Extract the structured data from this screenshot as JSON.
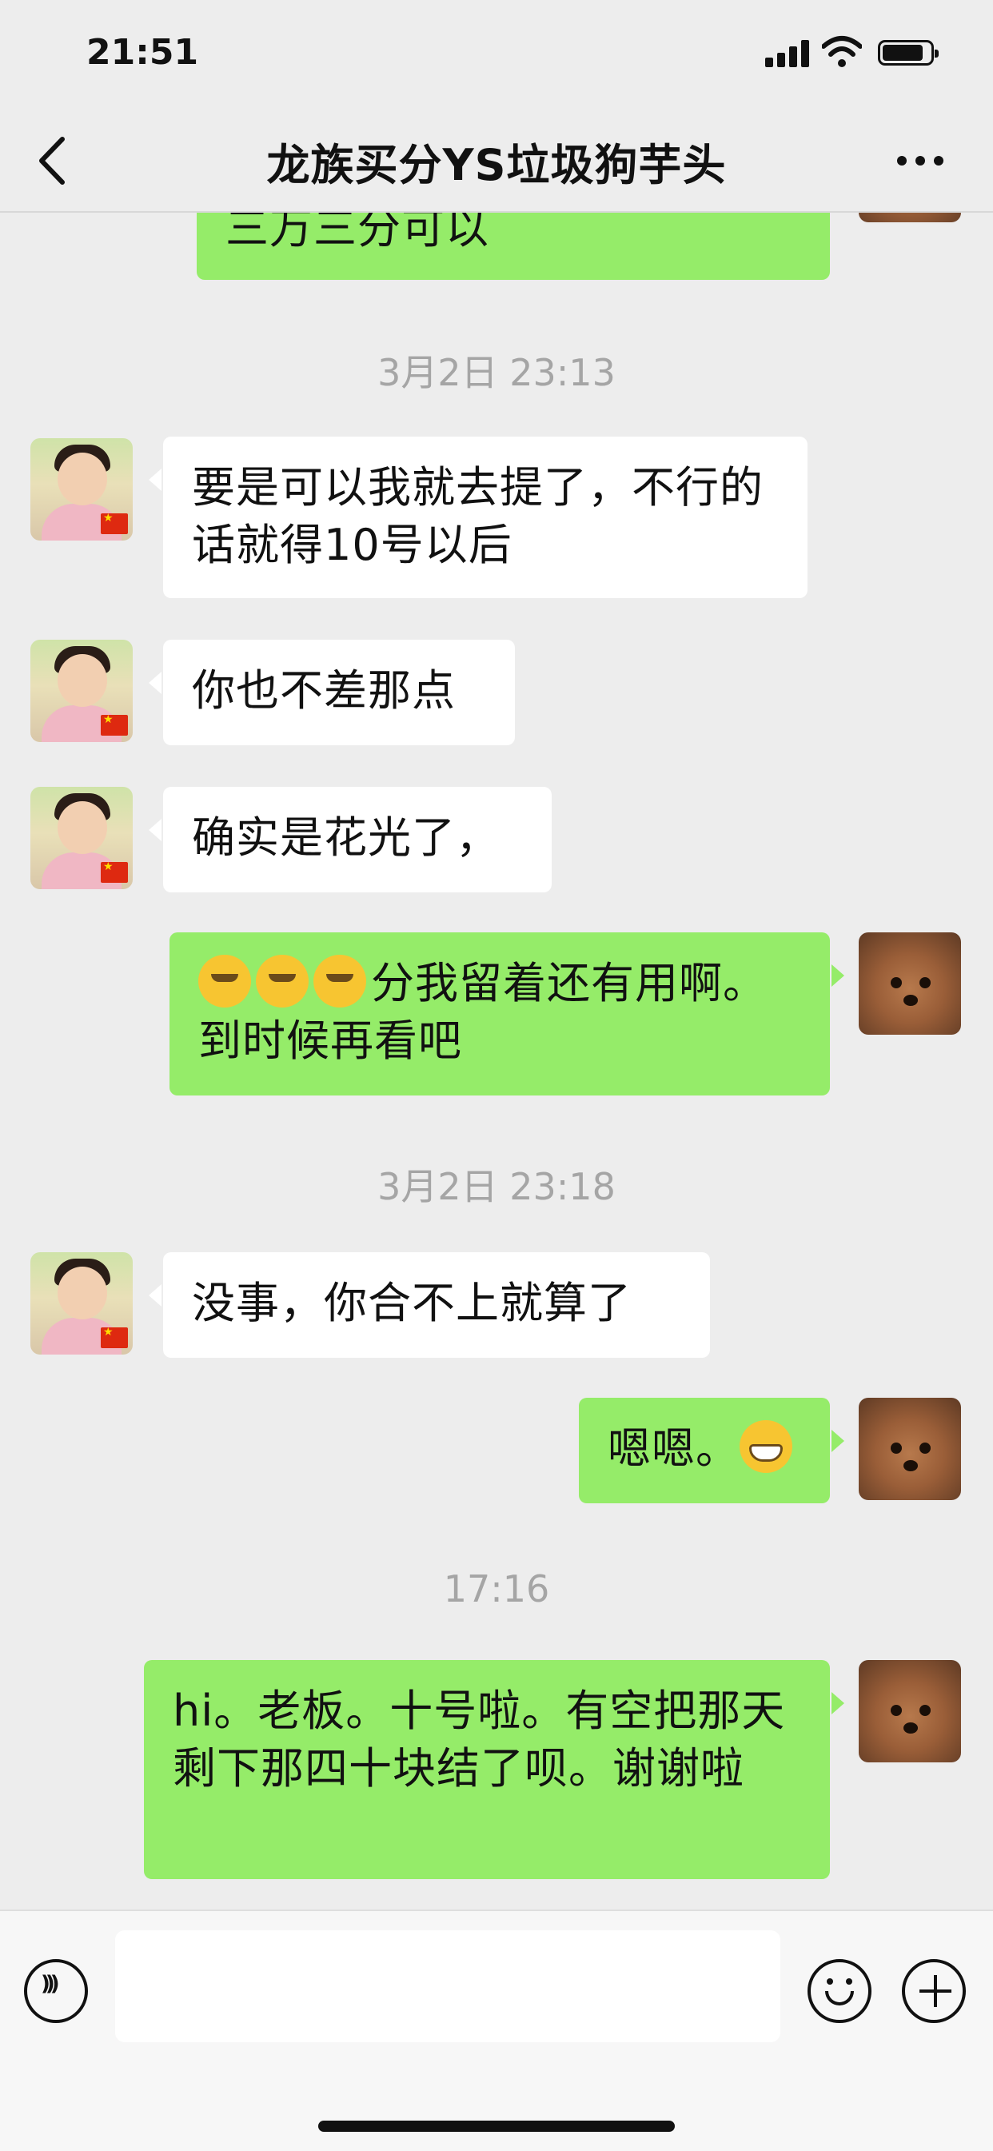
{
  "status_bar": {
    "time": "21:51"
  },
  "header": {
    "title": "龙族买分YS垃圾狗芋头"
  },
  "messages": [
    {
      "type": "text",
      "side": "out",
      "text": "三万三分可以"
    },
    {
      "type": "timestamp",
      "text": "3月2日 23:13"
    },
    {
      "type": "text",
      "side": "in",
      "text": "要是可以我就去提了，不行的话就得10号以后"
    },
    {
      "type": "text",
      "side": "in",
      "text": "你也不差那点"
    },
    {
      "type": "text",
      "side": "in",
      "text": "确实是花光了，"
    },
    {
      "type": "text",
      "side": "out",
      "emojis": [
        "sweat-emoji",
        "sweat-emoji",
        "sweat-emoji"
      ],
      "text": "分我留着还有用啊。到时候再看吧"
    },
    {
      "type": "timestamp",
      "text": "3月2日 23:18"
    },
    {
      "type": "text",
      "side": "in",
      "text": "没事，你合不上就算了"
    },
    {
      "type": "text",
      "side": "out",
      "text": "嗯嗯。",
      "emojis_after": [
        "grin-emoji"
      ]
    },
    {
      "type": "timestamp",
      "text": "17:16"
    },
    {
      "type": "text",
      "side": "out",
      "text": "hi。老板。十号啦。有空把那天剩下那四十块结了呗。谢谢啦"
    }
  ],
  "input_bar": {
    "value": "",
    "icons": [
      "voice-icon",
      "emoji-icon",
      "plus-icon"
    ]
  },
  "colors": {
    "outgoing_bubble": "#95ec69",
    "incoming_bubble": "#ffffff",
    "background": "#ededed"
  }
}
